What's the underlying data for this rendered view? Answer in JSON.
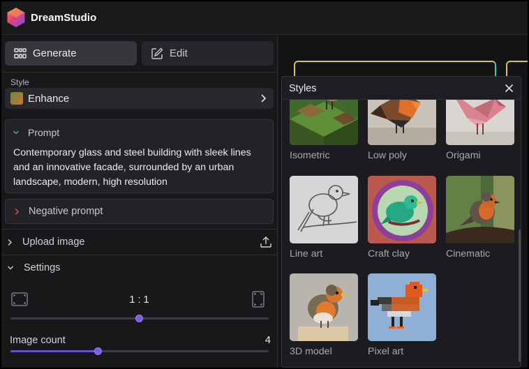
{
  "app": {
    "name": "DreamStudio"
  },
  "tabs": {
    "generate": "Generate",
    "edit": "Edit"
  },
  "style": {
    "label": "Style",
    "selected": "Enhance"
  },
  "prompt": {
    "label": "Prompt",
    "text": "Contemporary glass and steel building with sleek lines and an innovative facade, surrounded by an urban landscape, modern, high resolution"
  },
  "negative_prompt": {
    "label": "Negative prompt"
  },
  "upload": {
    "label": "Upload image"
  },
  "settings": {
    "label": "Settings",
    "aspect_ratio": {
      "value": "1 : 1",
      "slider_fraction": 0.5
    },
    "image_count": {
      "label": "Image count",
      "value": "4",
      "slider_fraction": 0.34
    }
  },
  "styles_modal": {
    "title": "Styles",
    "items": [
      {
        "label": "Isometric"
      },
      {
        "label": "Low poly"
      },
      {
        "label": "Origami"
      },
      {
        "label": "Line art"
      },
      {
        "label": "Craft clay"
      },
      {
        "label": "Cinematic"
      },
      {
        "label": "3D model"
      },
      {
        "label": "Pixel art"
      }
    ]
  },
  "colors": {
    "accent": "#7b5ce6",
    "panel": "#18181b",
    "field": "#28282d"
  },
  "icons": [
    "app-logo-icon",
    "grid-icon",
    "edit-icon",
    "chevron-right-icon",
    "chevron-down-icon",
    "upload-icon",
    "aspect-landscape-icon",
    "aspect-portrait-icon",
    "close-icon"
  ]
}
